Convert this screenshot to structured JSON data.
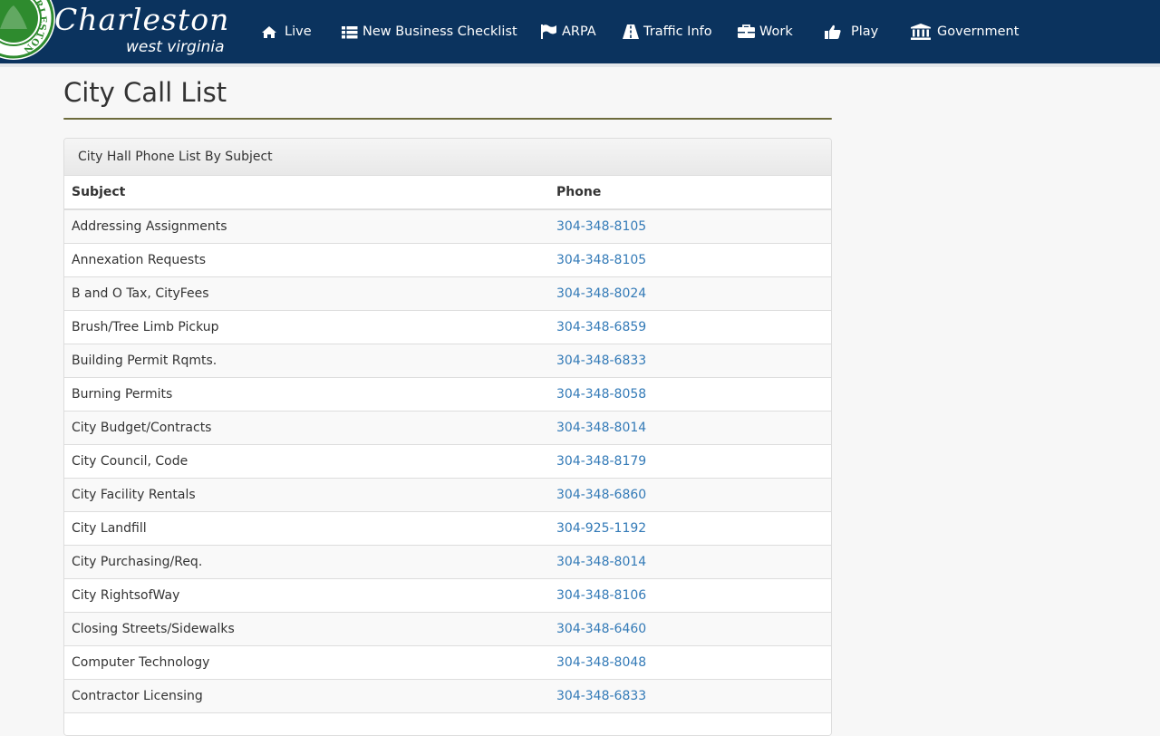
{
  "brand": {
    "title": "Charleston",
    "subtitle": "west virginia",
    "seal_text": "CHARLESTON",
    "colors": {
      "navbar": "#0b335e",
      "seal": "#2e8b2e",
      "link": "#337ab7"
    }
  },
  "nav": [
    {
      "label": "Live",
      "icon": "home-icon"
    },
    {
      "label": "New Business Checklist",
      "icon": "list-icon"
    },
    {
      "label": "ARPA",
      "icon": "flag-icon"
    },
    {
      "label": "Traffic Info",
      "icon": "road-icon"
    },
    {
      "label": "Work",
      "icon": "briefcase-icon"
    },
    {
      "label": "Play",
      "icon": "thumbs-up-icon"
    },
    {
      "label": "Government",
      "icon": "institution-icon"
    }
  ],
  "page": {
    "title": "City Call List"
  },
  "panel": {
    "heading": "City Hall Phone List By Subject",
    "columns": {
      "subject": "Subject",
      "phone": "Phone"
    },
    "rows": [
      {
        "subject": "Addressing Assignments",
        "phone": "304-348-8105"
      },
      {
        "subject": "Annexation Requests",
        "phone": "304-348-8105"
      },
      {
        "subject": "B and O Tax, CityFees",
        "phone": "304-348-8024"
      },
      {
        "subject": "Brush/Tree Limb Pickup",
        "phone": "304-348-6859"
      },
      {
        "subject": "Building Permit Rqmts.",
        "phone": "304-348-6833"
      },
      {
        "subject": "Burning Permits",
        "phone": "304-348-8058"
      },
      {
        "subject": "City Budget/Contracts",
        "phone": "304-348-8014"
      },
      {
        "subject": "City Council, Code",
        "phone": "304-348-8179"
      },
      {
        "subject": "City Facility Rentals",
        "phone": "304-348-6860"
      },
      {
        "subject": "City Landfill",
        "phone": "304-925-1192"
      },
      {
        "subject": "City Purchasing/Req.",
        "phone": "304-348-8014"
      },
      {
        "subject": "City RightsofWay",
        "phone": "304-348-8106"
      },
      {
        "subject": "Closing Streets/Sidewalks",
        "phone": "304-348-6460"
      },
      {
        "subject": "Computer Technology",
        "phone": "304-348-8048"
      },
      {
        "subject": "Contractor Licensing",
        "phone": "304-348-6833"
      }
    ]
  }
}
